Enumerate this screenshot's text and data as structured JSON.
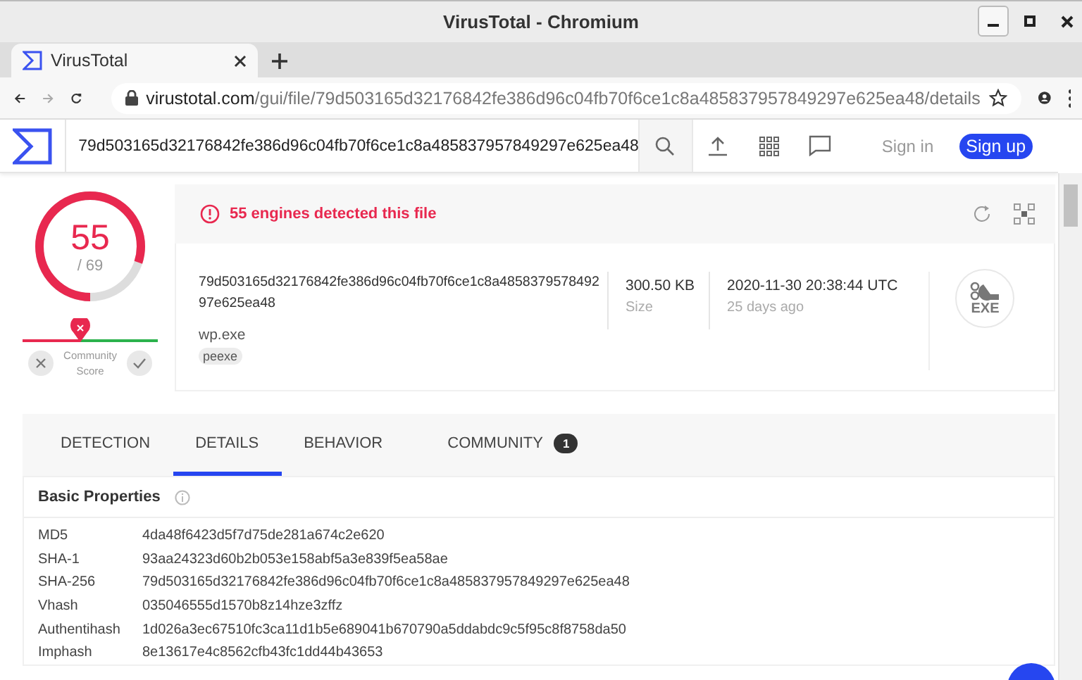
{
  "window": {
    "title": "VirusTotal - Chromium"
  },
  "tabs": [
    {
      "label": "VirusTotal",
      "selected": true
    }
  ],
  "address_bar": {
    "host": "virustotal.com",
    "path": "/gui/file/79d503165d32176842fe386d96c04fb70f6ce1c8a485837957849297e625ea48/details"
  },
  "site_header": {
    "search_value": "79d503165d32176842fe386d96c04fb70f6ce1c8a485837957849297e625ea48",
    "sign_in": "Sign in",
    "sign_up": "Sign up"
  },
  "score": {
    "detections": "55",
    "total": "/ 69",
    "level": 0.8,
    "community": {
      "label": "Community Score",
      "level": 0.43
    }
  },
  "alert": "55 engines detected this file",
  "file": {
    "hash_line_1": "79d503165d32176842fe386d96c04fb70f6ce1c8a4858379578492",
    "hash_line_2": "97e625ea48",
    "name": "wp.exe",
    "tag": "peexe",
    "size": "300.50 KB",
    "size_label": "Size",
    "date": "2020-11-30 20:38:44 UTC",
    "date_ago": "25 days ago",
    "type_label": "EXE"
  },
  "section_tabs": [
    {
      "label": "DETECTION",
      "selected": false
    },
    {
      "label": "DETAILS",
      "selected": true
    },
    {
      "label": "BEHAVIOR",
      "selected": false
    },
    {
      "label": "COMMUNITY",
      "selected": false,
      "badge": "1"
    }
  ],
  "basic_properties": {
    "title": "Basic Properties",
    "rows": [
      {
        "key": "MD5",
        "value": "4da48f6423d5f7d75de281a674c2e620"
      },
      {
        "key": "SHA-1",
        "value": "93aa24323d60b2b053e158abf5a3e839f5ea58ae"
      },
      {
        "key": "SHA-256",
        "value": "79d503165d32176842fe386d96c04fb70f6ce1c8a485837957849297e625ea48"
      },
      {
        "key": "Vhash",
        "value": "035046555d1570b8z14hze3zffz"
      },
      {
        "key": "Authentihash",
        "value": "1d026a3ec67510fc3ca11d1b5e689041b670790a5ddabdc9c5f95c8f8758da50"
      },
      {
        "key": "Imphash",
        "value": "8e13617e4c8562cfb43fc1dd44b43653"
      }
    ]
  }
}
